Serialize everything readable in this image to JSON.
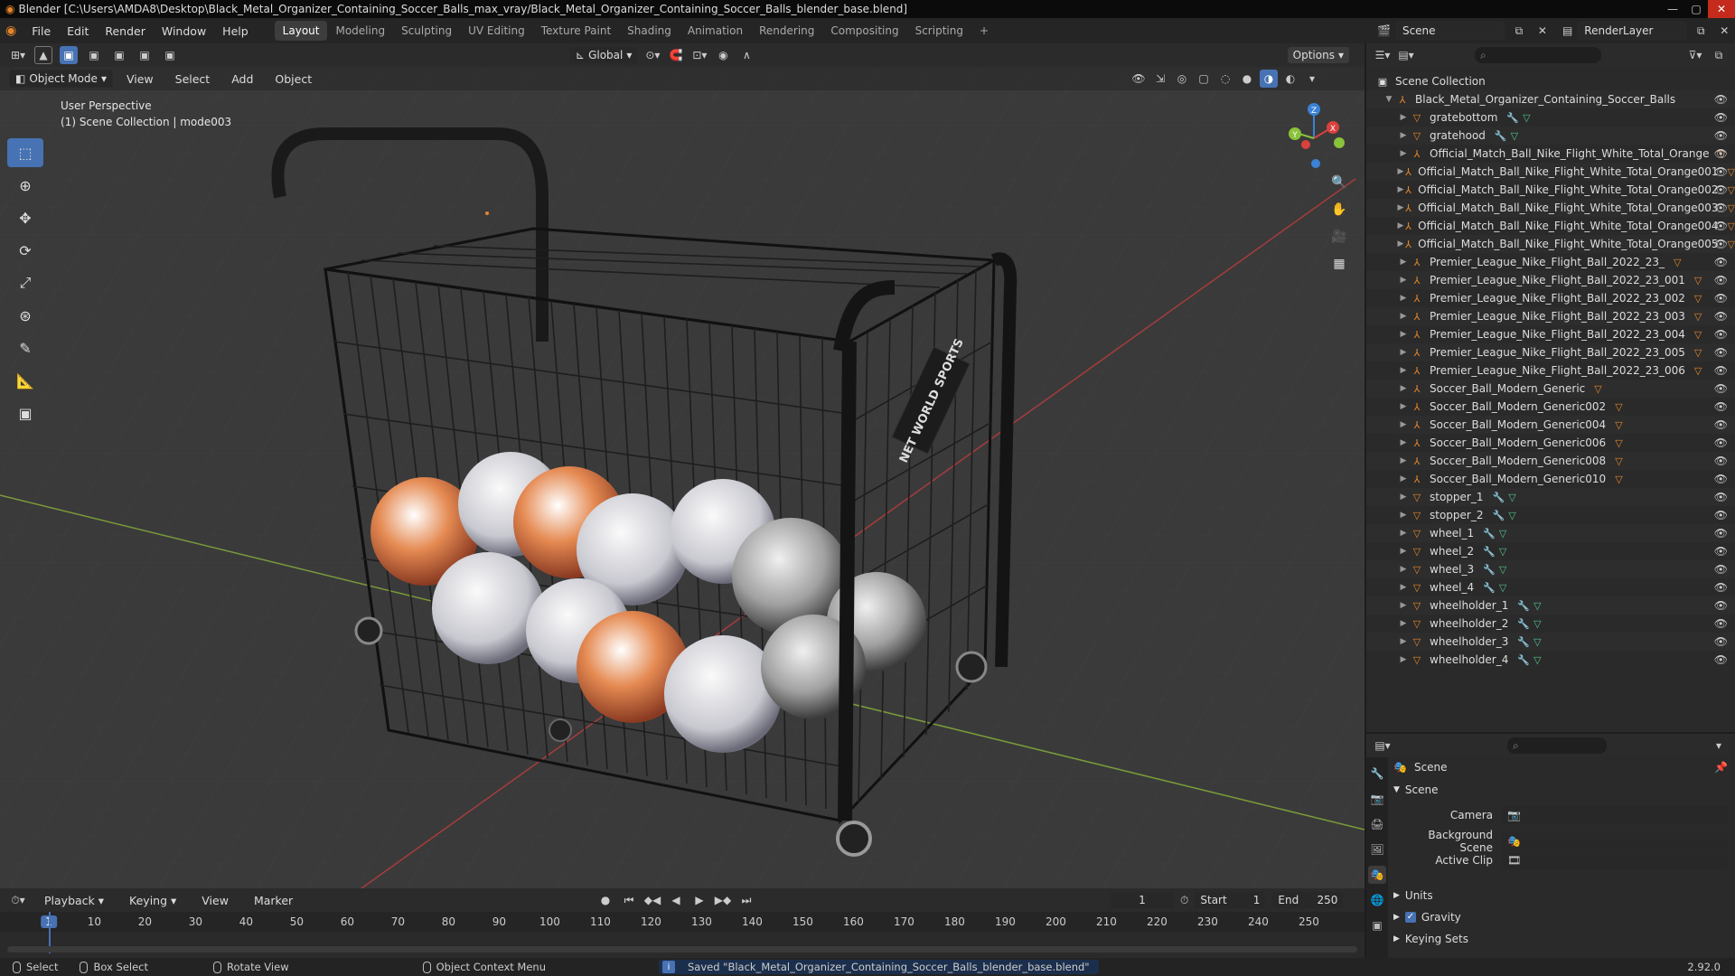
{
  "window": {
    "title": "Blender [C:\\Users\\AMDA8\\Desktop\\Black_Metal_Organizer_Containing_Soccer_Balls_max_vray/Black_Metal_Organizer_Containing_Soccer_Balls_blender_base.blend]"
  },
  "menu": [
    "File",
    "Edit",
    "Render",
    "Window",
    "Help"
  ],
  "workspaces": [
    "Layout",
    "Modeling",
    "Sculpting",
    "UV Editing",
    "Texture Paint",
    "Shading",
    "Animation",
    "Rendering",
    "Compositing",
    "Scripting"
  ],
  "active_workspace": "Layout",
  "scene_selector": {
    "scene": "Scene",
    "view_layer": "RenderLayer"
  },
  "header": {
    "orientation": "Global",
    "options": "Options"
  },
  "viewport_header": {
    "mode": "Object Mode",
    "menus": [
      "View",
      "Select",
      "Add",
      "Object"
    ]
  },
  "viewport": {
    "perspective": "User Perspective",
    "collection_info": "(1) Scene Collection | mode003",
    "sign_text": "NET WORLD SPORTS"
  },
  "gizmo": {
    "x": "X",
    "y": "Y",
    "z": "Z"
  },
  "outliner": {
    "root": "Scene Collection",
    "group": "Black_Metal_Organizer_Containing_Soccer_Balls",
    "items": [
      {
        "name": "gratebottom",
        "type": "mesh"
      },
      {
        "name": "gratehood",
        "type": "mesh"
      },
      {
        "name": "Official_Match_Ball_Nike_Flight_White_Total_Orange",
        "type": "empty"
      },
      {
        "name": "Official_Match_Ball_Nike_Flight_White_Total_Orange001",
        "type": "empty"
      },
      {
        "name": "Official_Match_Ball_Nike_Flight_White_Total_Orange002",
        "type": "empty"
      },
      {
        "name": "Official_Match_Ball_Nike_Flight_White_Total_Orange003",
        "type": "empty"
      },
      {
        "name": "Official_Match_Ball_Nike_Flight_White_Total_Orange004",
        "type": "empty"
      },
      {
        "name": "Official_Match_Ball_Nike_Flight_White_Total_Orange005",
        "type": "empty"
      },
      {
        "name": "Premier_League_Nike_Flight_Ball_2022_23_",
        "type": "empty"
      },
      {
        "name": "Premier_League_Nike_Flight_Ball_2022_23_001",
        "type": "empty"
      },
      {
        "name": "Premier_League_Nike_Flight_Ball_2022_23_002",
        "type": "empty"
      },
      {
        "name": "Premier_League_Nike_Flight_Ball_2022_23_003",
        "type": "empty"
      },
      {
        "name": "Premier_League_Nike_Flight_Ball_2022_23_004",
        "type": "empty"
      },
      {
        "name": "Premier_League_Nike_Flight_Ball_2022_23_005",
        "type": "empty"
      },
      {
        "name": "Premier_League_Nike_Flight_Ball_2022_23_006",
        "type": "empty"
      },
      {
        "name": "Soccer_Ball_Modern_Generic",
        "type": "empty"
      },
      {
        "name": "Soccer_Ball_Modern_Generic002",
        "type": "empty"
      },
      {
        "name": "Soccer_Ball_Modern_Generic004",
        "type": "empty"
      },
      {
        "name": "Soccer_Ball_Modern_Generic006",
        "type": "empty"
      },
      {
        "name": "Soccer_Ball_Modern_Generic008",
        "type": "empty"
      },
      {
        "name": "Soccer_Ball_Modern_Generic010",
        "type": "empty"
      },
      {
        "name": "stopper_1",
        "type": "mesh"
      },
      {
        "name": "stopper_2",
        "type": "mesh"
      },
      {
        "name": "wheel_1",
        "type": "mesh"
      },
      {
        "name": "wheel_2",
        "type": "mesh"
      },
      {
        "name": "wheel_3",
        "type": "mesh"
      },
      {
        "name": "wheel_4",
        "type": "mesh"
      },
      {
        "name": "wheelholder_1",
        "type": "mesh"
      },
      {
        "name": "wheelholder_2",
        "type": "mesh"
      },
      {
        "name": "wheelholder_3",
        "type": "mesh"
      },
      {
        "name": "wheelholder_4",
        "type": "mesh"
      }
    ]
  },
  "properties": {
    "title": "Scene",
    "panel": "Scene",
    "camera_label": "Camera",
    "background_label": "Background Scene",
    "active_clip_label": "Active Clip",
    "sections": [
      "Units",
      "Gravity",
      "Keying Sets"
    ]
  },
  "timeline": {
    "menus": [
      "Playback",
      "Keying",
      "View",
      "Marker"
    ],
    "current_frame": "1",
    "start_label": "Start",
    "start": "1",
    "end_label": "End",
    "end": "250",
    "ticks": [
      "1",
      "10",
      "20",
      "30",
      "40",
      "50",
      "60",
      "70",
      "80",
      "90",
      "100",
      "110",
      "120",
      "130",
      "140",
      "150",
      "160",
      "170",
      "180",
      "190",
      "200",
      "210",
      "220",
      "230",
      "240",
      "250"
    ]
  },
  "statusbar": {
    "select": "Select",
    "box_select": "Box Select",
    "rotate": "Rotate View",
    "context": "Object Context Menu",
    "message": "Saved \"Black_Metal_Organizer_Containing_Soccer_Balls_blender_base.blend\"",
    "version": "2.92.0"
  },
  "colors": {
    "accent": "#4772b3",
    "x_axis": "#d9413e",
    "y_axis": "#8ac23a",
    "z_axis": "#3b82d6",
    "orange": "#e5862b"
  }
}
